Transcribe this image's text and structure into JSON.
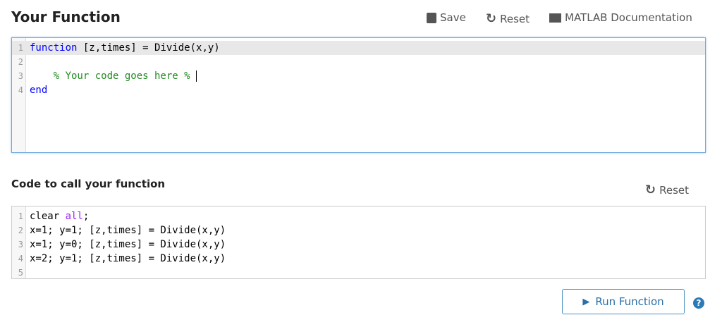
{
  "title": "Your Function",
  "toolbar": {
    "save": "Save",
    "reset": "Reset",
    "docs": "MATLAB Documentation"
  },
  "function_editor": {
    "lines": [
      {
        "n": "1",
        "parts": [
          {
            "t": "function",
            "c": "kw"
          },
          {
            "t": " [z,times] = Divide(x,y)",
            "c": ""
          }
        ]
      },
      {
        "n": "2",
        "parts": []
      },
      {
        "n": "3",
        "parts": [
          {
            "t": "    % Your code goes here % ",
            "c": "cm"
          }
        ]
      },
      {
        "n": "4",
        "parts": [
          {
            "t": "end",
            "c": "kw"
          }
        ]
      }
    ]
  },
  "call_section": {
    "title": "Code to call your function",
    "reset": "Reset"
  },
  "call_editor": {
    "lines": [
      {
        "n": "1",
        "parts": [
          {
            "t": "clear ",
            "c": ""
          },
          {
            "t": "all",
            "c": "str"
          },
          {
            "t": ";",
            "c": ""
          }
        ]
      },
      {
        "n": "2",
        "parts": [
          {
            "t": "x=1; y=1; [z,times] = Divide(x,y)",
            "c": ""
          }
        ]
      },
      {
        "n": "3",
        "parts": [
          {
            "t": "x=1; y=0; [z,times] = Divide(x,y)",
            "c": ""
          }
        ]
      },
      {
        "n": "4",
        "parts": [
          {
            "t": "x=2; y=1; [z,times] = Divide(x,y)",
            "c": ""
          }
        ]
      },
      {
        "n": "5",
        "parts": []
      }
    ]
  },
  "run_button": "Run Function",
  "help": "?"
}
